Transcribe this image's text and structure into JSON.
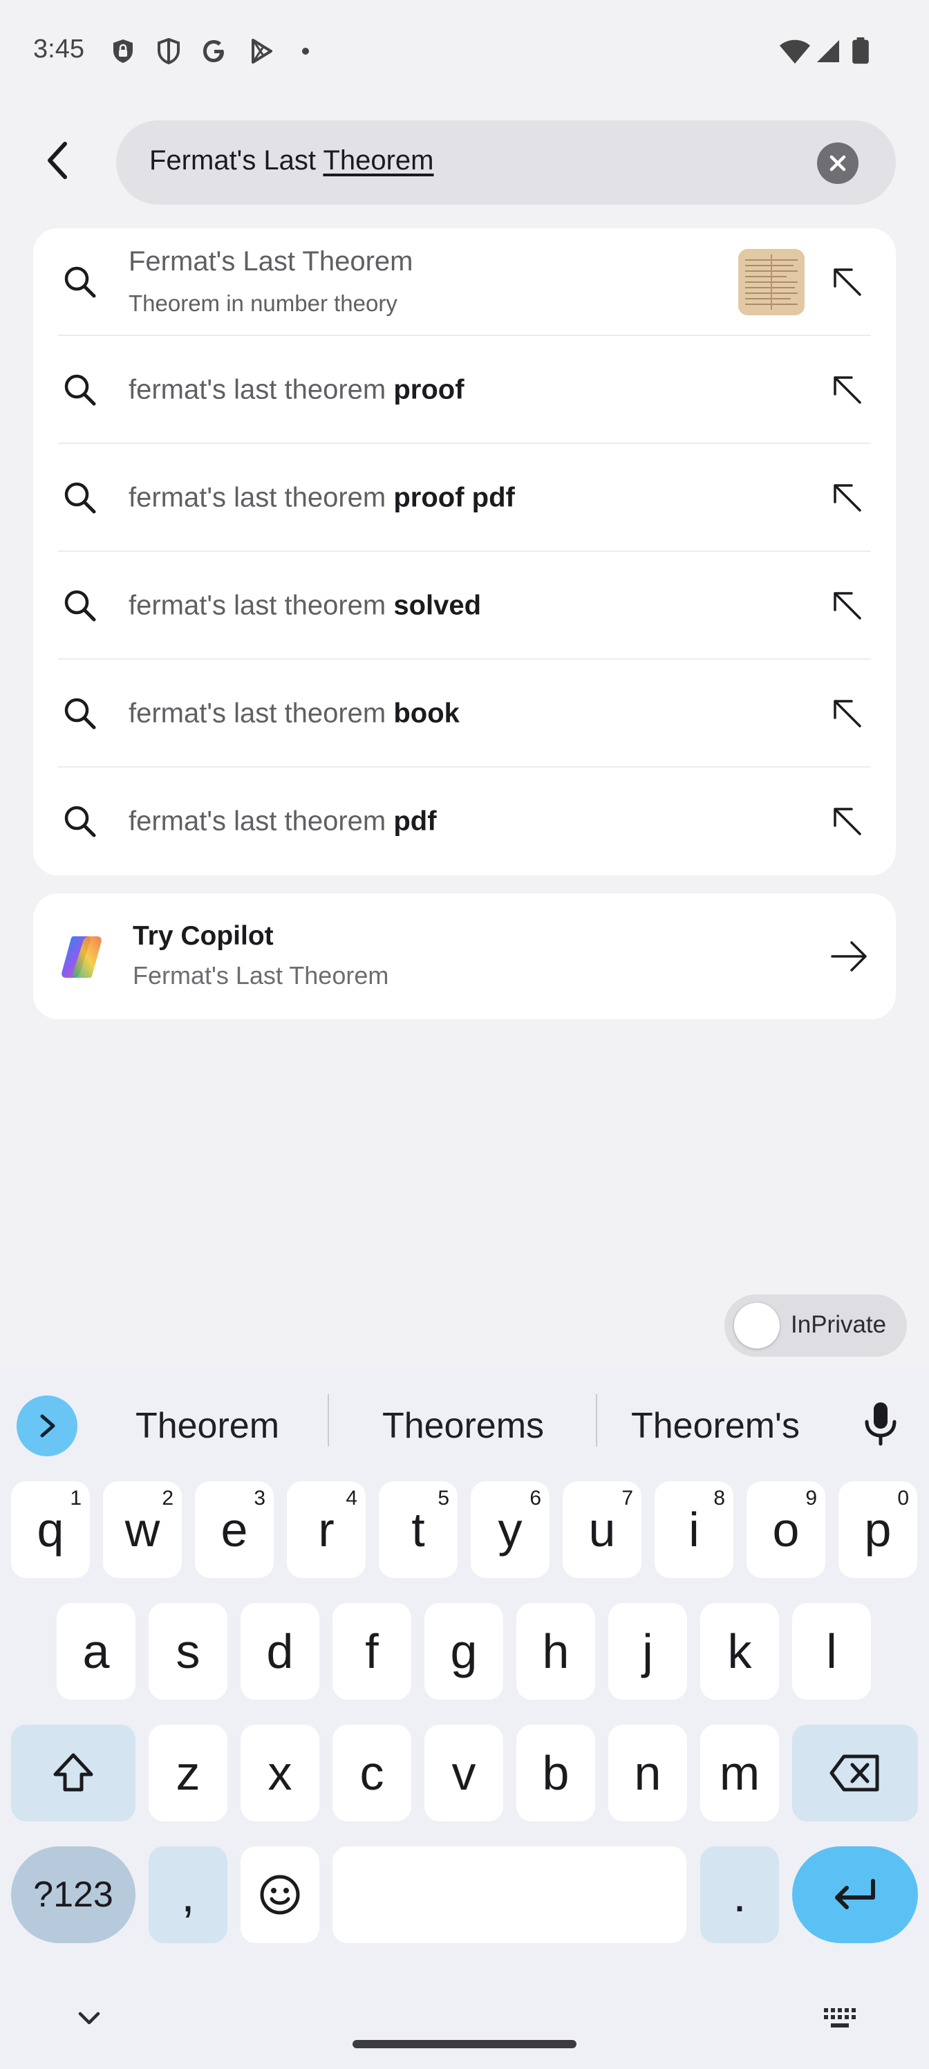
{
  "status_bar": {
    "time": "3:45",
    "icons": [
      "vpn-lock-icon",
      "shield-icon",
      "google-icon",
      "play-store-icon",
      "dot-icon",
      "wifi-icon",
      "signal-icon",
      "battery-icon"
    ]
  },
  "search": {
    "query_plain": "Fermat's Last ",
    "query_underlined": "Theorem"
  },
  "suggestions": {
    "top": {
      "title": "Fermat's Last Theorem",
      "subtitle": "Theorem in number theory"
    },
    "items": [
      {
        "prefix": "fermat's last theorem ",
        "bold": "proof"
      },
      {
        "prefix": "fermat's last theorem ",
        "bold": "proof pdf"
      },
      {
        "prefix": "fermat's last theorem ",
        "bold": "solved"
      },
      {
        "prefix": "fermat's last theorem ",
        "bold": "book"
      },
      {
        "prefix": "fermat's last theorem ",
        "bold": "pdf"
      }
    ]
  },
  "copilot": {
    "title": "Try Copilot",
    "subtitle": "Fermat's Last Theorem"
  },
  "inprivate": {
    "label": "InPrivate",
    "enabled": false
  },
  "keyboard": {
    "suggestions": [
      "Theorem",
      "Theorems",
      "Theorem's"
    ],
    "row1": [
      {
        "k": "q",
        "n": "1"
      },
      {
        "k": "w",
        "n": "2"
      },
      {
        "k": "e",
        "n": "3"
      },
      {
        "k": "r",
        "n": "4"
      },
      {
        "k": "t",
        "n": "5"
      },
      {
        "k": "y",
        "n": "6"
      },
      {
        "k": "u",
        "n": "7"
      },
      {
        "k": "i",
        "n": "8"
      },
      {
        "k": "o",
        "n": "9"
      },
      {
        "k": "p",
        "n": "0"
      }
    ],
    "row2": [
      "a",
      "s",
      "d",
      "f",
      "g",
      "h",
      "j",
      "k",
      "l"
    ],
    "row3": [
      "z",
      "x",
      "c",
      "v",
      "b",
      "n",
      "m"
    ],
    "sym_label": "?123",
    "comma": ",",
    "period": "."
  },
  "colors": {
    "accent": "#5bc1f4",
    "fn_key": "#d4e4f1",
    "sym_key": "#b6cadb"
  }
}
